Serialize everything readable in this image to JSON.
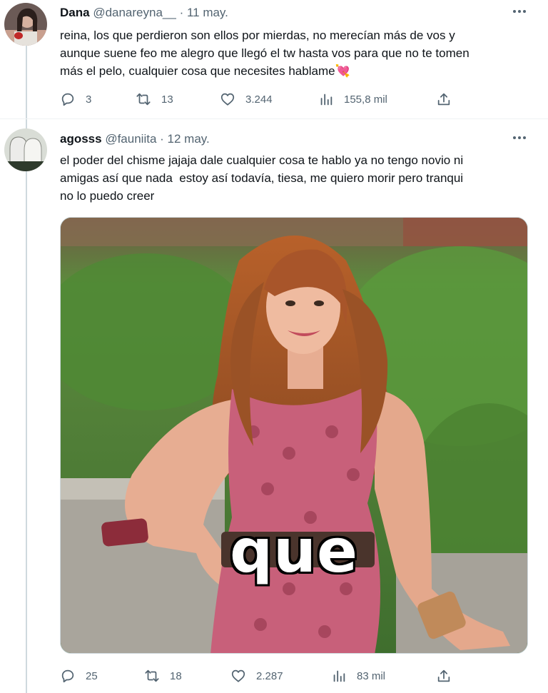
{
  "tweets": [
    {
      "author": "Dana",
      "handle": "@danareyna__",
      "date": "· 11 may.",
      "text": "reina, los que perdieron son ellos por mierdas, no merecían más de vos y\naunque suene feo me alegro que llegó el tw hasta vos para que no te tomen\nmás el pelo, cualquier cosa que necesites hablame💘",
      "replies": "3",
      "retweets": "13",
      "likes": "3.244",
      "views": "155,8 mil"
    },
    {
      "author": "agosss",
      "handle": "@fauniita",
      "date": "· 12 may.",
      "text": "el poder del chisme jajaja dale cualquier cosa te hablo ya no tengo novio ni\namigas así que nada  estoy así todavía, tiesa, me quiero morir pero tranqui\nno lo puedo creer",
      "media_caption": "que",
      "replies": "25",
      "retweets": "18",
      "likes": "2.287",
      "views": "83 mil"
    }
  ],
  "colors": {
    "text": "#0f1419",
    "secondary": "#536471",
    "divider": "#eff3f4",
    "thread_line": "#cfd9de"
  },
  "icons": [
    "reply-icon",
    "retweet-icon",
    "like-icon",
    "views-icon",
    "share-icon",
    "more-icon"
  ]
}
